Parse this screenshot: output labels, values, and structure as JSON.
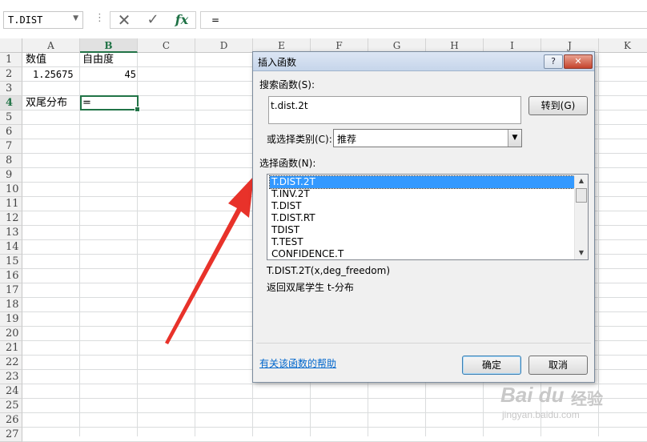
{
  "formula_bar": {
    "name_box": "T.DIST",
    "separator": "⋮",
    "cancel_icon": "✕",
    "enter_icon": "✓",
    "fx_label": "fx",
    "content": "="
  },
  "columns": [
    "A",
    "B",
    "C",
    "D",
    "E",
    "F",
    "G",
    "H",
    "I",
    "J",
    "K"
  ],
  "rows": [
    "1",
    "2",
    "3",
    "4",
    "5",
    "6",
    "7",
    "8",
    "9",
    "10",
    "11",
    "12",
    "13",
    "14",
    "15",
    "16",
    "17",
    "18",
    "19",
    "20",
    "21",
    "22",
    "23",
    "24",
    "25",
    "26",
    "27"
  ],
  "cells": {
    "a1": "数值",
    "b1": "自由度",
    "a2": "1.25675",
    "b2": "45",
    "a4": "双尾分布",
    "b4": "="
  },
  "dialog": {
    "title": "插入函数",
    "help_button": "?",
    "close_button": "✕",
    "search_label": "搜索函数(S):",
    "search_value": "t.dist.2t",
    "go_button": "转到(G)",
    "category_label": "或选择类别(C):",
    "category_value": "推荐",
    "select_label": "选择函数(N):",
    "functions": [
      "T.DIST.2T",
      "T.INV.2T",
      "T.DIST",
      "T.DIST.RT",
      "TDIST",
      "T.TEST",
      "CONFIDENCE.T"
    ],
    "selected_index": 0,
    "syntax": "T.DIST.2T(x,deg_freedom)",
    "description": "返回双尾学生 t-分布",
    "help_link": "有关该函数的帮助",
    "ok_button": "确定",
    "cancel_button": "取消"
  },
  "watermark": {
    "logo": "Bai du",
    "label": "经验",
    "url": "jingyan.baidu.com"
  },
  "colors": {
    "excel_green": "#217346",
    "selection_blue": "#3399ff",
    "arrow_red": "#e8322a"
  }
}
